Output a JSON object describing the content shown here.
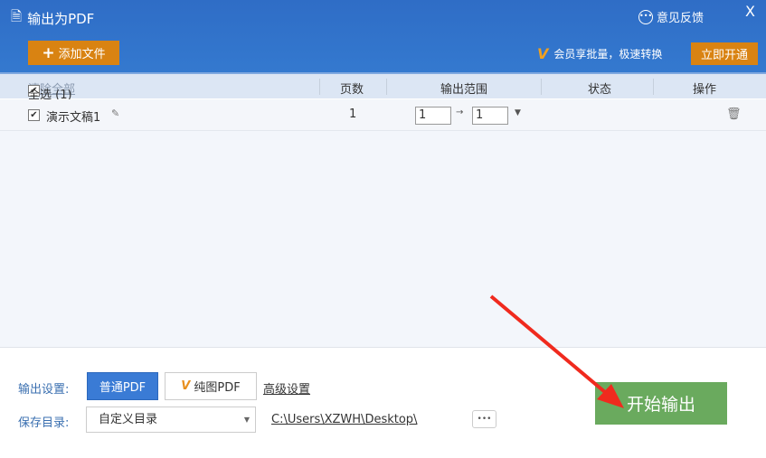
{
  "header": {
    "title": "输出为PDF",
    "feedback": "意见反馈",
    "close": "X",
    "add_file": "添加文件",
    "promo": "会员享批量，极速转换",
    "open_vip": "立即开通"
  },
  "table": {
    "select_all": "全选 (1)",
    "clear_all": "清除全部",
    "columns": [
      "页数",
      "输出范围",
      "状态",
      "操作"
    ],
    "rows": [
      {
        "name": "演示文稿1",
        "pages": "1",
        "range_from": "1",
        "range_to": "1",
        "status": ""
      }
    ]
  },
  "settings": {
    "output_label": "输出设置:",
    "normal_pdf": "普通PDF",
    "image_pdf": "纯图PDF",
    "advanced": "高级设置",
    "save_label": "保存目录:",
    "dir_option": "自定义目录",
    "path": "C:\\Users\\XZWH\\Desktop\\",
    "browse": "•••",
    "start": "开始输出"
  }
}
